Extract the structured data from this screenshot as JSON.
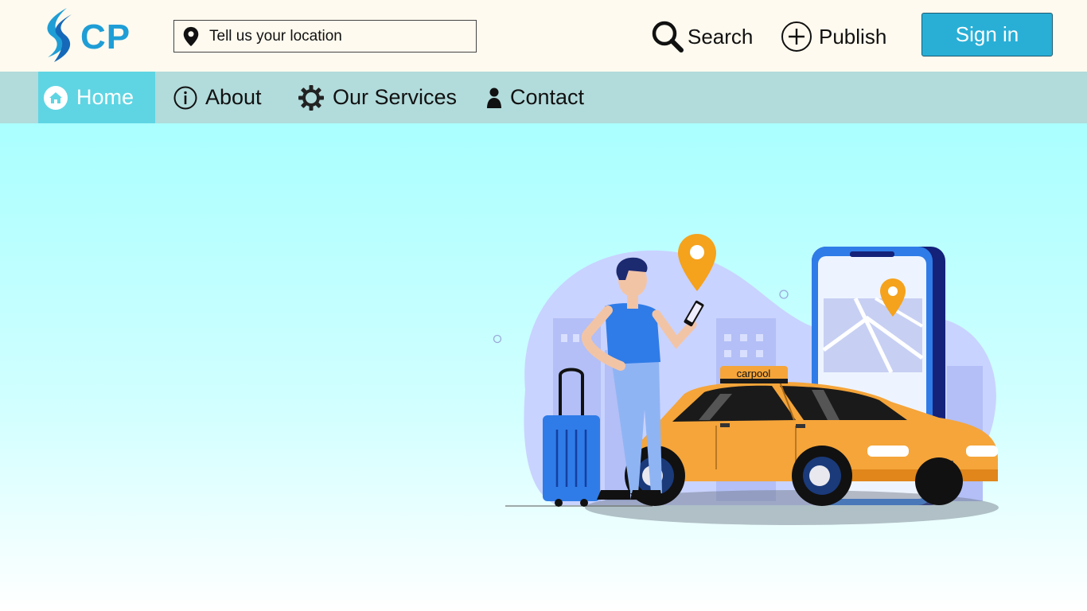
{
  "header": {
    "logo_text": "CP",
    "location_placeholder": "Tell us your location",
    "search_label": "Search",
    "publish_label": "Publish",
    "signin_label": "Sign in"
  },
  "nav": {
    "items": [
      {
        "label": "Home",
        "icon": "home-icon",
        "active": true
      },
      {
        "label": "About",
        "icon": "info-icon"
      },
      {
        "label": "Our Services",
        "icon": "gear-icon"
      },
      {
        "label": "Contact",
        "icon": "person-icon"
      }
    ]
  },
  "hero": {
    "taxi_sign": "carpool"
  },
  "colors": {
    "topbar_bg": "#fffaef",
    "nav_bg": "#b2dbdb",
    "nav_active_bg": "#5fd5e3",
    "signin_bg": "#29afd6",
    "logo_blue": "#1f9ed6",
    "taxi_orange": "#f5a53a"
  }
}
